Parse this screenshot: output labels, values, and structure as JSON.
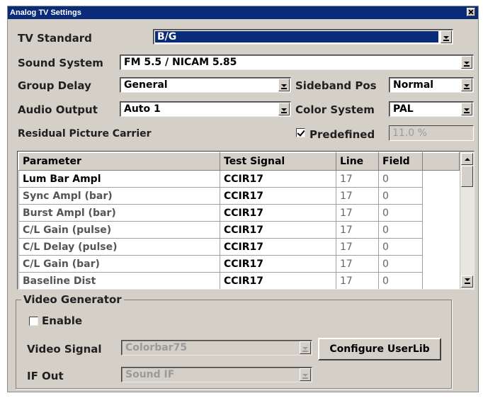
{
  "window": {
    "title": "Analog TV Settings"
  },
  "fields": {
    "tv_standard": {
      "label": "TV Standard",
      "value": "B/G"
    },
    "sound_system": {
      "label": "Sound System",
      "value": "FM 5.5 / NICAM 5.85"
    },
    "group_delay": {
      "label": "Group Delay",
      "value": "General"
    },
    "sideband_pos": {
      "label": "Sideband Pos",
      "value": "Normal"
    },
    "audio_output": {
      "label": "Audio Output",
      "value": "Auto 1"
    },
    "color_system": {
      "label": "Color System",
      "value": "PAL"
    },
    "residual_carrier": {
      "label": "Residual Picture Carrier",
      "predefined_label": "Predefined",
      "predefined_checked": true,
      "value": "11.0 %"
    }
  },
  "table": {
    "headers": [
      "Parameter",
      "Test Signal",
      "Line",
      "Field",
      ""
    ],
    "rows": [
      {
        "parameter": "Lum Bar Ampl",
        "signal": "CCIR17",
        "line": "17",
        "field": "0"
      },
      {
        "parameter": "Sync Ampl (bar)",
        "signal": "CCIR17",
        "line": "17",
        "field": "0"
      },
      {
        "parameter": "Burst Ampl (bar)",
        "signal": "CCIR17",
        "line": "17",
        "field": "0"
      },
      {
        "parameter": "C/L Gain (pulse)",
        "signal": "CCIR17",
        "line": "17",
        "field": "0"
      },
      {
        "parameter": "C/L Delay (pulse)",
        "signal": "CCIR17",
        "line": "17",
        "field": "0"
      },
      {
        "parameter": "C/L Gain (bar)",
        "signal": "CCIR17",
        "line": "17",
        "field": "0"
      },
      {
        "parameter": "Baseline Dist",
        "signal": "CCIR17",
        "line": "17",
        "field": "0"
      }
    ]
  },
  "video_generator": {
    "title": "Video Generator",
    "enable_label": "Enable",
    "enable_checked": false,
    "video_signal_label": "Video Signal",
    "video_signal_value": "Colorbar75",
    "configure_button": "Configure UserLib",
    "if_out_label": "IF Out",
    "if_out_value": "Sound IF"
  }
}
